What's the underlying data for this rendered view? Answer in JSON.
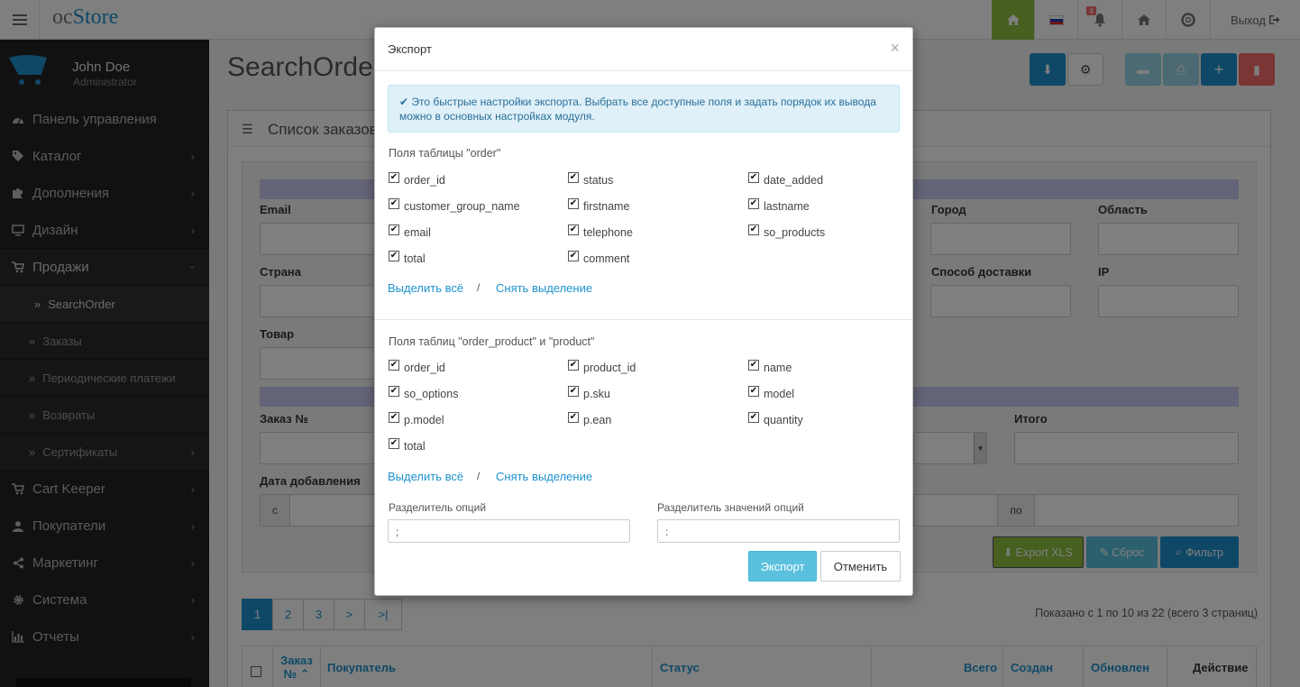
{
  "header": {
    "logo_oc": "oc",
    "logo_store": "Store",
    "notification_count": "4",
    "logout_label": "Выход"
  },
  "user": {
    "name": "John Doe",
    "role": "Administrator"
  },
  "sidebar": {
    "items": [
      {
        "label": "Панель управления",
        "icon": "dashboard-icon"
      },
      {
        "label": "Каталог",
        "icon": "tag-icon"
      },
      {
        "label": "Дополнения",
        "icon": "puzzle-icon"
      },
      {
        "label": "Дизайн",
        "icon": "monitor-icon"
      },
      {
        "label": "Продажи",
        "icon": "cart-icon"
      },
      {
        "label": "SearchOrder",
        "icon": "double-chevron-icon"
      },
      {
        "label": "Заказы",
        "icon": "double-chevron-icon"
      },
      {
        "label": "Периодические платежи",
        "icon": "double-chevron-icon"
      },
      {
        "label": "Возвраты",
        "icon": "double-chevron-icon"
      },
      {
        "label": "Сертификаты",
        "icon": "double-chevron-icon"
      },
      {
        "label": "Cart Keeper",
        "icon": "cart-icon"
      },
      {
        "label": "Покупатели",
        "icon": "user-icon"
      },
      {
        "label": "Маркетинг",
        "icon": "share-icon"
      },
      {
        "label": "Система",
        "icon": "gear-icon"
      },
      {
        "label": "Отчеты",
        "icon": "bar-chart-icon"
      }
    ]
  },
  "page": {
    "title": "SearchOrder",
    "panel_title": "Список заказов",
    "filter": {
      "email_label": "Email",
      "city_label": "Город",
      "region_label": "Область",
      "country_label": "Страна",
      "shipping_label": "Способ доставки",
      "ip_label": "IP",
      "product_label": "Товар",
      "order_no_label": "Заказ №",
      "total_label": "Итого",
      "date_added_label": "Дата добавления",
      "from_label": "с",
      "to_label": "по",
      "export_xls": "Export XLS",
      "reset": "Сброс",
      "filter": "Фильтр"
    },
    "pagination": [
      "1",
      "2",
      "3",
      ">",
      ">|"
    ],
    "results_text": "Показано с 1 по 10 из 22 (всего 3 страниц)",
    "table_headers": {
      "order_line1": "Заказ",
      "order_line2": "№ ⌃",
      "customer": "Покупатель",
      "status": "Статус",
      "total": "Всего",
      "created": "Создан",
      "updated": "Обновлен",
      "action": "Действие"
    }
  },
  "modal": {
    "title": "Экспорт",
    "close": "×",
    "alert": "✔ Это быстрые настройки экспорта. Выбрать все доступные поля и задать порядок их вывода можно в основных настройках модуля.",
    "order_section": "Поля таблицы \"order\"",
    "order_fields": [
      "order_id",
      "status",
      "date_added",
      "customer_group_name",
      "firstname",
      "lastname",
      "email",
      "telephone",
      "so_products",
      "total",
      "comment"
    ],
    "product_section": "Поля таблиц \"order_product\" и \"product\"",
    "product_fields": [
      "order_id",
      "product_id",
      "name",
      "so_options",
      "p.sku",
      "model",
      "p.model",
      "p.ean",
      "quantity",
      "total"
    ],
    "select_all": "Выделить всё",
    "separator": "/",
    "deselect": "Снять выделение",
    "option_sep_label": "Разделитель опций",
    "option_sep_value": ";",
    "value_sep_label": "Разделитель значений опций",
    "value_sep_value": ":",
    "export_btn": "Экспорт",
    "cancel_btn": "Отменить"
  },
  "colors": {
    "accent": "#1e91cf",
    "sidebar": "#222222",
    "green": "#8fbf3f",
    "danger": "#f56b6b",
    "info": "#5bc0de"
  }
}
